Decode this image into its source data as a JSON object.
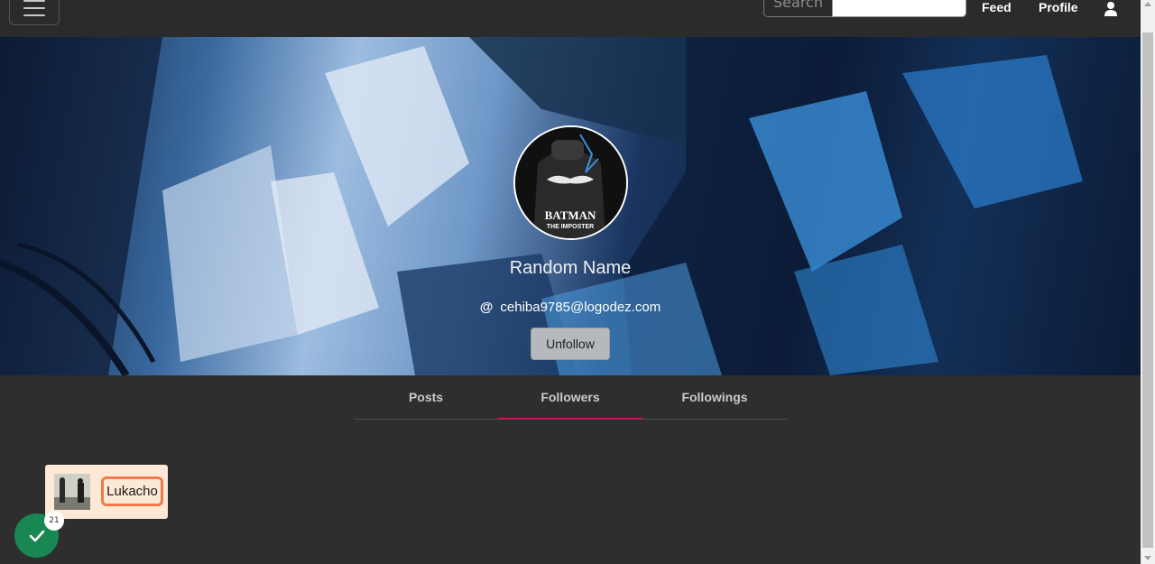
{
  "navbar": {
    "search_label": "Search",
    "search_placeholder": "",
    "feed_label": "Feed",
    "profile_label": "Profile"
  },
  "profile": {
    "display_name": "Random Name",
    "email": "cehiba9785@logodez.com",
    "avatar_text_line1": "BATMAN",
    "avatar_text_line2": "THE IMPOSTER",
    "unfollow_label": "Unfollow"
  },
  "tabs": [
    {
      "label": "Posts",
      "active": false
    },
    {
      "label": "Followers",
      "active": true
    },
    {
      "label": "Followings",
      "active": false
    }
  ],
  "followers": [
    {
      "name": "Lukacho"
    }
  ],
  "notification": {
    "count": "21"
  },
  "colors": {
    "page_bg": "#2e2e2e",
    "navbar_bg": "#2b2b2b",
    "active_tab_underline": "#c2185b",
    "card_bg": "#fde9d5",
    "card_name_border": "#f07a4a",
    "notify_green": "#198754"
  },
  "icons": {
    "menu": "hamburger-icon",
    "user": "user-icon",
    "email": "at-icon",
    "notify": "check-icon"
  }
}
